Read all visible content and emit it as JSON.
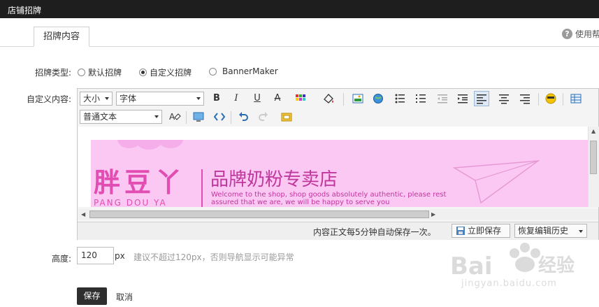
{
  "window": {
    "title": "店铺招牌"
  },
  "tabs": [
    {
      "label": "招牌内容"
    }
  ],
  "help": {
    "label": "使用帮",
    "icon": "question-circle-icon"
  },
  "form": {
    "type_label": "招牌类型:",
    "type_options": [
      {
        "label": "默认招牌",
        "selected": false
      },
      {
        "label": "自定义招牌",
        "selected": true
      },
      {
        "label": "BannerMaker",
        "selected": false
      }
    ],
    "content_label": "自定义内容:",
    "height_label": "高度:",
    "height_value": "120",
    "height_unit": "px",
    "height_hint": "建议不超过120px，否则导航显示可能异常",
    "save_label": "保存",
    "cancel_label": "取消"
  },
  "editor": {
    "font_size_select": "大小",
    "font_family_select": "字体",
    "format_select": "普通文本",
    "autosave_note": "内容正文每5分钟自动保存一次。",
    "save_now": "立即保存",
    "restore_history": "恢复编辑历史",
    "toolbar_icons": [
      "bold-icon",
      "italic-icon",
      "underline-icon",
      "strikethrough-icon",
      "color-grid-icon",
      "fill-color-icon",
      "image-icon",
      "globe-link-icon",
      "bullet-list-icon",
      "numbered-list-icon",
      "outdent-icon",
      "indent-icon",
      "align-left-icon",
      "align-center-icon",
      "align-right-icon",
      "emoticon-icon",
      "table-icon",
      "clear-format-icon",
      "media-icon",
      "source-code-icon",
      "undo-icon",
      "redo-icon",
      "template-icon"
    ]
  },
  "banner": {
    "brand_cn": "胖豆丫",
    "brand_en": "PANG DOU YA",
    "shop_name": "品牌奶粉专卖店",
    "shop_en_line1": "Welcome to the shop, shop goods absolutely authentic, please rest",
    "shop_en_line2": "assured that we are, we will be happy to serve you"
  },
  "watermark": {
    "text": "Baidu经验",
    "url": "jingyan.baidu.com"
  },
  "colors": {
    "titlebar": "#1e1e1e",
    "banner_bg": "#fbc8f4",
    "banner_text": "#e14db0"
  }
}
